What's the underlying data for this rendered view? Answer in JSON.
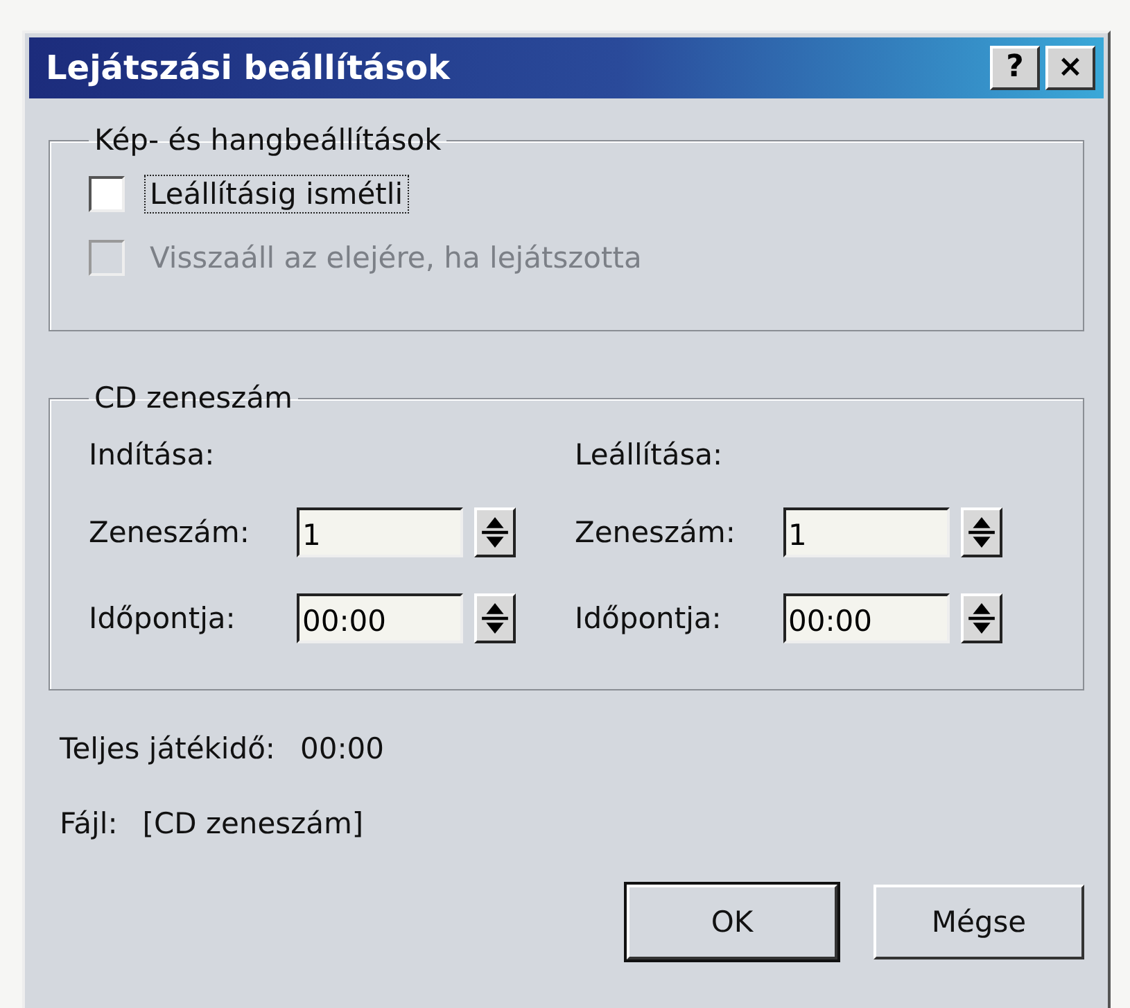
{
  "window": {
    "title": "Lejátszási beállítások",
    "title_buttons": [
      "?",
      "×"
    ]
  },
  "media_group": {
    "title": "Kép- és hangbeállítások",
    "checkboxes": [
      {
        "label": "Leállításig ismétli",
        "checked": false,
        "disabled": false,
        "focused": true
      },
      {
        "label": "Visszaáll az elejére, ha lejátszotta",
        "checked": false,
        "disabled": true,
        "focused": false
      }
    ]
  },
  "cd_group": {
    "title": "CD zeneszám",
    "columns": [
      {
        "heading": "Indítása:",
        "fields": [
          {
            "label": "Zeneszám:",
            "value": "1"
          },
          {
            "label": "Időpontja:",
            "value": "00:00"
          }
        ]
      },
      {
        "heading": "Leállítása:",
        "fields": [
          {
            "label": "Zeneszám:",
            "value": "1"
          },
          {
            "label": "Időpontja:",
            "value": "00:00"
          }
        ]
      }
    ]
  },
  "total": {
    "label": "Teljes játékidő:",
    "value": "00:00"
  },
  "file": {
    "label": "Fájl:",
    "value": "[CD zeneszám]"
  },
  "buttons": [
    {
      "label": "OK",
      "default": true
    },
    {
      "label": "Mégse",
      "default": false
    }
  ]
}
